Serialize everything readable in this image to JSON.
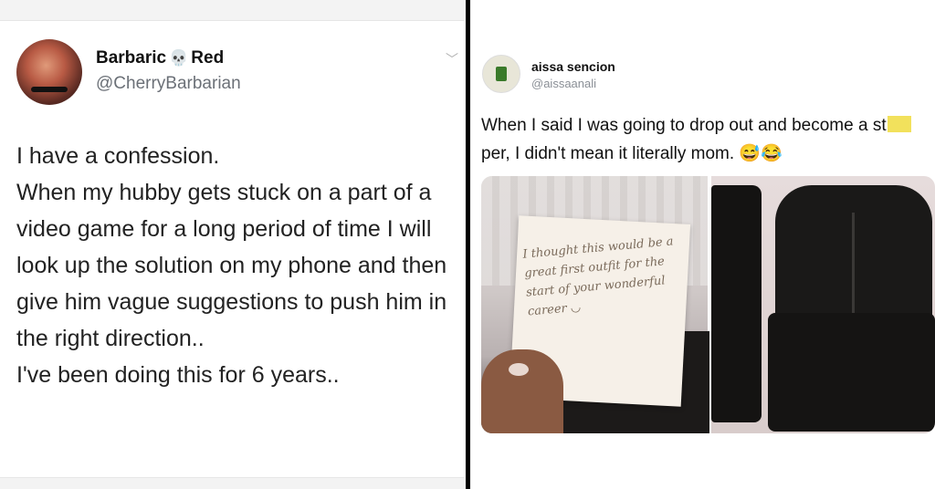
{
  "left_tweet": {
    "display_name_first": "Barbaric",
    "display_name_last": "Red",
    "handle": "@CherryBarbarian",
    "lines": [
      "I have a confession.",
      "When my hubby gets stuck on a part of a video game for a long period of time I will look up the solution on my phone and then give him vague suggestions to push him in the right direction..",
      "I've been doing this for 6 years.."
    ]
  },
  "right_tweet": {
    "display_name": "aissa sencion",
    "handle": "@aissaanali",
    "text_part1": "When I said I was going to drop out and become a st",
    "text_part2": "per, I didn't mean it literally mom.",
    "emoji": "😅😂",
    "note_text": "I thought this would be a great first outfit for the start of your wonderful career ◡"
  },
  "colors": {
    "divider": "#000000",
    "censor": "#f2e15c",
    "handle_gray": "#6b7077"
  },
  "icons": [
    "skull-icon",
    "chevron-down-icon"
  ]
}
